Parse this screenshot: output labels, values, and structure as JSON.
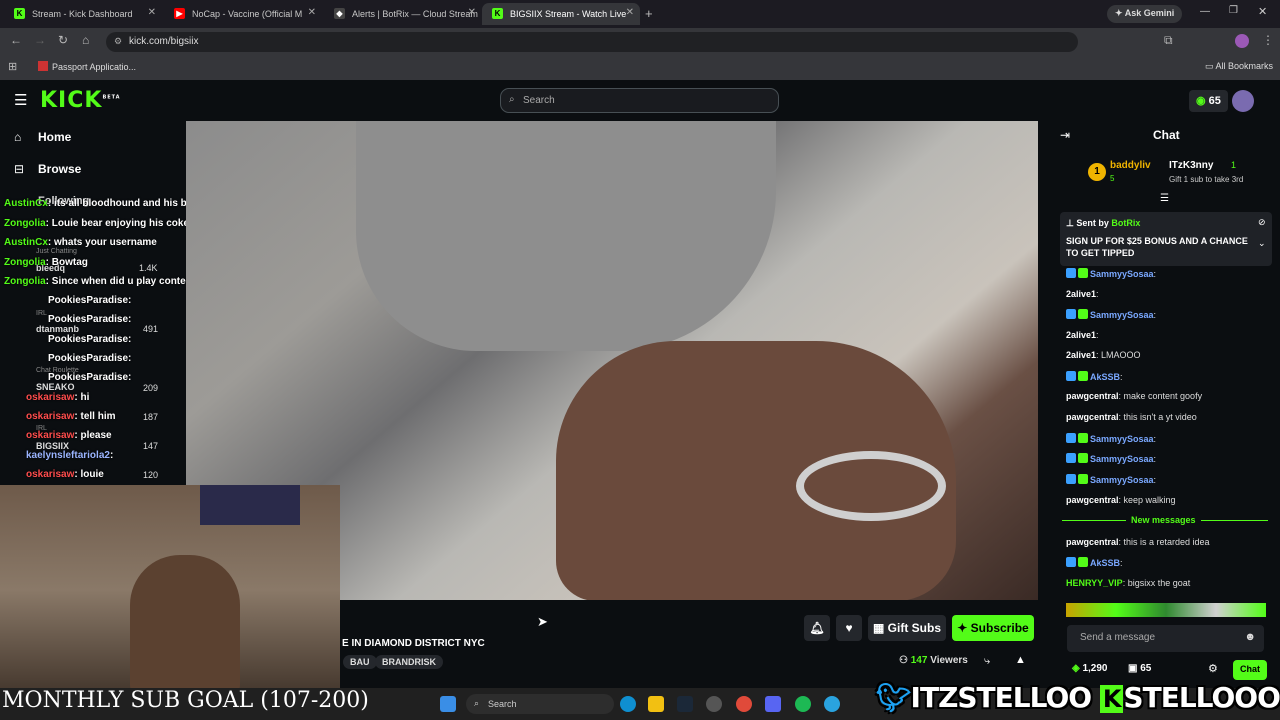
{
  "browser": {
    "tabs": [
      {
        "title": "Stream - Kick Dashboard",
        "icon": "kick-icon"
      },
      {
        "title": "NoCap - Vaccine (Official M",
        "icon": "youtube-icon"
      },
      {
        "title": "Alerts | BotRix — Cloud Stream",
        "icon": "botrix-icon"
      },
      {
        "title": "BIGSIIX Stream - Watch Live",
        "icon": "kick-icon"
      }
    ],
    "url": "kick.com/bigsiix",
    "ask_gemini": "Ask Gemini",
    "bookmark_item": "Passport Applicatio...",
    "all_bookmarks": "All Bookmarks"
  },
  "kick": {
    "logo": "KICK",
    "logo_beta": "BETA",
    "search_placeholder": "Search",
    "points": "65"
  },
  "sidebar": {
    "home": "Home",
    "browse": "Browse",
    "following": "Following"
  },
  "overlay_chat": [
    {
      "user": "AustinCx",
      "text": ": its all bloodhound and his bots"
    },
    {
      "user": "Zongolia",
      "text": ": Louie bear enjoying his coke huh"
    },
    {
      "user": "AustinCx",
      "text": ": whats your username"
    },
    {
      "user": "Zongolia",
      "text": ": Bowtag"
    },
    {
      "user": "Zongolia",
      "text": ": Since when did u play content king"
    },
    {
      "user": "PookiesParadise",
      "text": ":"
    },
    {
      "user": "PookiesParadise",
      "text": ":"
    },
    {
      "user": "PookiesParadise",
      "text": ":"
    },
    {
      "user": "PookiesParadise",
      "text": ":"
    },
    {
      "user": "PookiesParadise",
      "text": ":"
    },
    {
      "user": "oskarisaw",
      "text": ": hi"
    },
    {
      "user": "oskarisaw",
      "text": ": tell him"
    },
    {
      "user": "oskarisaw",
      "text": ": please"
    },
    {
      "user": "kaelynsleftariola2",
      "text": ":"
    },
    {
      "user": "oskarisaw",
      "text": ": louie"
    }
  ],
  "sidebar_channels": [
    {
      "name": "bleedq",
      "viewers": "1.4K",
      "category": "Just Chatting"
    },
    {
      "name": "dtanmanb",
      "viewers": "491",
      "category": "IRL"
    },
    {
      "name": "SNEAKO",
      "viewers": "209",
      "category": "Chat Roulette"
    },
    {
      "name": "BIGSIIX",
      "viewers": "147",
      "category": "IRL"
    }
  ],
  "sidebar_viewer_counts": [
    "187",
    "120"
  ],
  "stream": {
    "title": "E IN DIAMOND DISTRICT NYC",
    "tags": [
      "BAU",
      "BRANDRISK"
    ],
    "viewers": "147",
    "viewers_label": "Viewers",
    "gift_subs": "Gift Subs",
    "subscribe": "Subscribe"
  },
  "chat": {
    "header": "Chat",
    "leader1_name": "baddyliv",
    "leader1_count": "5",
    "leader1_rank": "1",
    "leader2_name": "ITzK3nny",
    "leader2_count": "1",
    "gift_prompt": "Gift 1 sub to take 3rd",
    "pinned_by_label": "Sent by",
    "pinned_by": "BotRix",
    "pinned_text": "SIGN UP FOR $25 BONUS AND A CHANCE TO GET TIPPED",
    "messages": [
      {
        "user": "SammyySosaa",
        "text": ":"
      },
      {
        "user": "2alive1",
        "text": ":"
      },
      {
        "user": "SammyySosaa",
        "text": ":"
      },
      {
        "user": "2alive1",
        "text": ":"
      },
      {
        "user": "2alive1",
        "text": ": LMAOOO"
      },
      {
        "user": "AkSSB",
        "text": ":"
      },
      {
        "user": "pawgcentral",
        "text": ": make content goofy"
      },
      {
        "user": "pawgcentral",
        "text": ": this isn't a yt video"
      },
      {
        "user": "SammyySosaa",
        "text": ":"
      },
      {
        "user": "SammyySosaa",
        "text": ":"
      },
      {
        "user": "SammyySosaa",
        "text": ":"
      },
      {
        "user": "pawgcentral",
        "text": ": keep walking"
      }
    ],
    "new_messages": "New messages",
    "messages_after": [
      {
        "user": "pawgcentral",
        "text": ": this is a retarded idea"
      },
      {
        "user": "AkSSB",
        "text": ":"
      },
      {
        "user": "HENRYY_VIP",
        "text": ": bigsixx the goat"
      }
    ],
    "input_placeholder": "Send a message",
    "kick_coins": "1,290",
    "points": "65",
    "chat_button": "Chat"
  },
  "overlay": {
    "goal": "MONTHLY SUB GOAL (107-200)",
    "twitter": "ITZSTELLOO",
    "kick": "STELLOOO"
  },
  "taskbar": {
    "search": "Search"
  }
}
